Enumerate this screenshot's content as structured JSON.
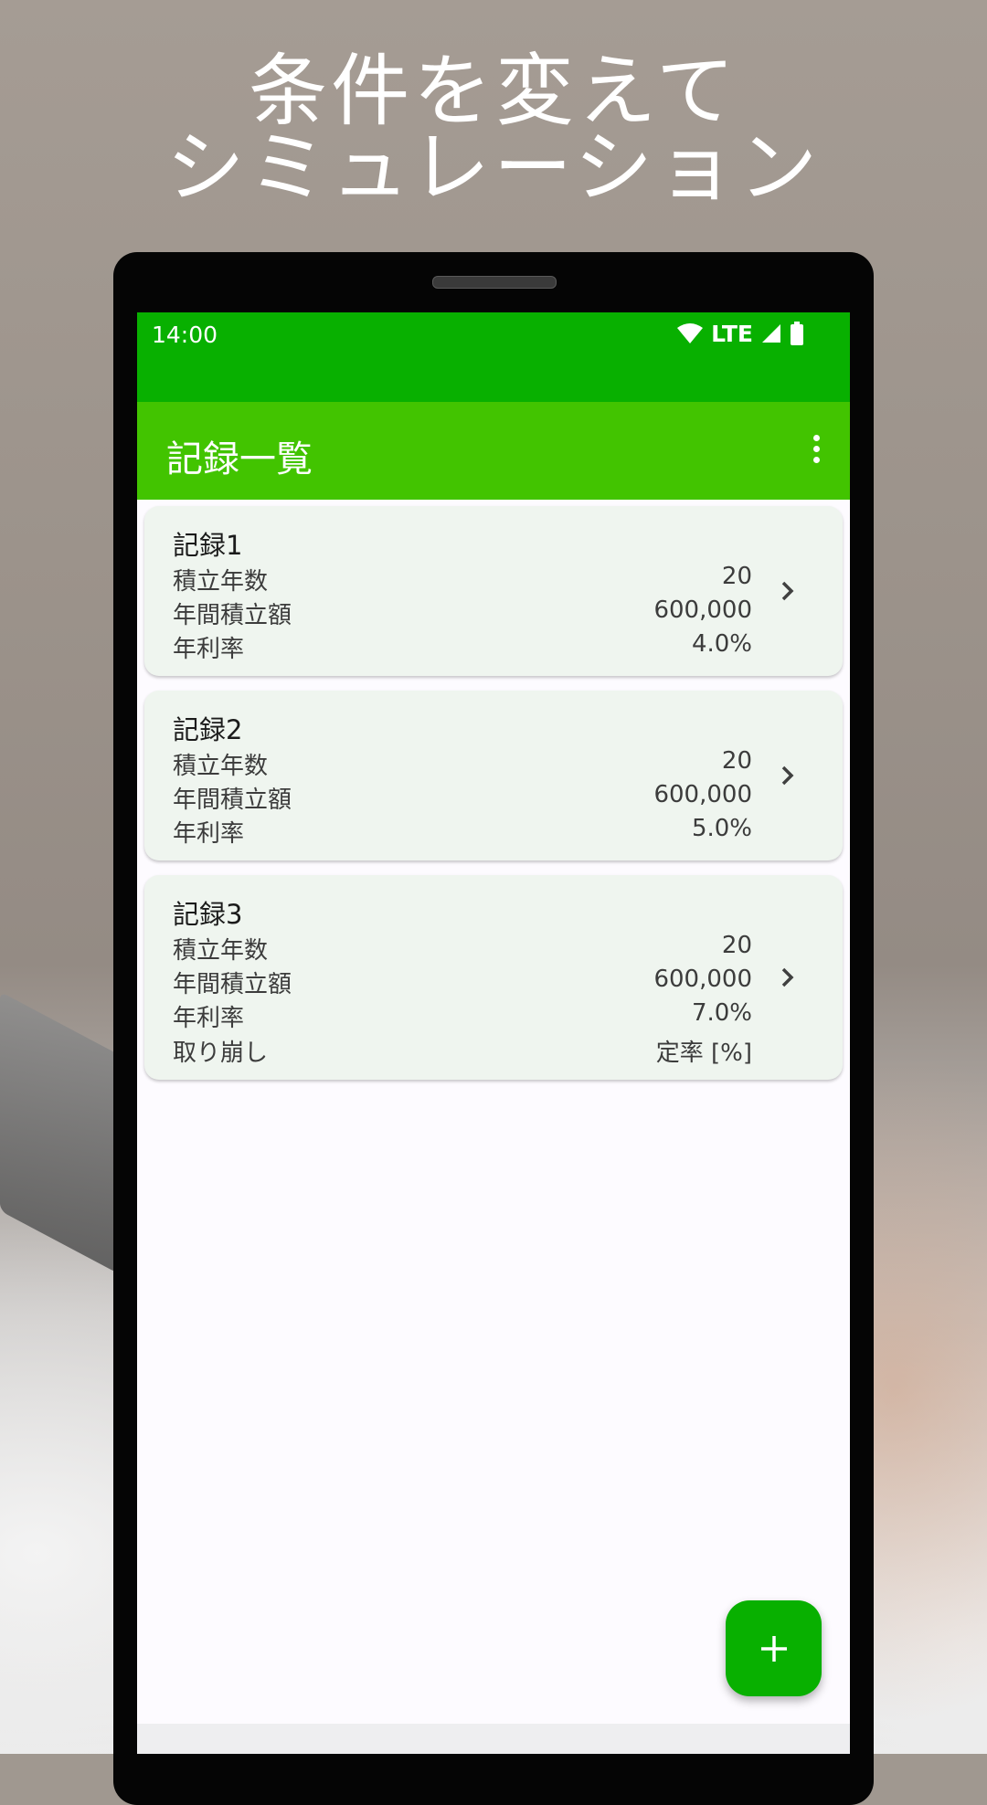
{
  "promo": {
    "line1": "条件を変えて",
    "line2": "シミュレーション"
  },
  "status_bar": {
    "time": "14:00",
    "network": "LTE"
  },
  "app_bar": {
    "title": "記録一覧",
    "menu_icon": "more-vert-icon"
  },
  "records": [
    {
      "title": "記録1",
      "rows": [
        {
          "label": "積立年数",
          "value": "20"
        },
        {
          "label": "年間積立額",
          "value": "600,000"
        },
        {
          "label": "年利率",
          "value": "4.0%"
        }
      ]
    },
    {
      "title": "記録2",
      "rows": [
        {
          "label": "積立年数",
          "value": "20"
        },
        {
          "label": "年間積立額",
          "value": "600,000"
        },
        {
          "label": "年利率",
          "value": "5.0%"
        }
      ]
    },
    {
      "title": "記録3",
      "rows": [
        {
          "label": "積立年数",
          "value": "20"
        },
        {
          "label": "年間積立額",
          "value": "600,000"
        },
        {
          "label": "年利率",
          "value": "7.0%"
        },
        {
          "label": "取り崩し",
          "value": "定率 [%]"
        }
      ]
    }
  ],
  "fab": {
    "icon": "plus-icon"
  },
  "colors": {
    "status_bar": "#08b000",
    "app_bar": "#42c400",
    "card": "#eff5ef",
    "fab": "#08b000"
  }
}
